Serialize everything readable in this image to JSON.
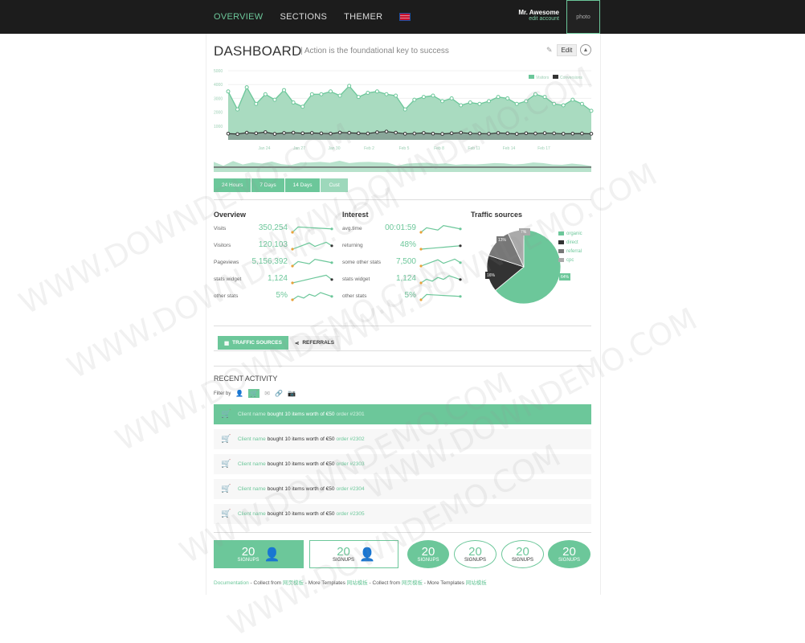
{
  "nav": {
    "items": [
      "OVERVIEW",
      "SECTIONS",
      "THEMER"
    ]
  },
  "user": {
    "name": "Mr. Awesome",
    "edit": "edit account",
    "photo": "photo"
  },
  "header": {
    "title": "DASHBOARD",
    "subtitle": "| Action is the foundational key to success",
    "edit": "Edit"
  },
  "chart_data": {
    "type": "line",
    "x": [
      "Jan 24",
      "Jan 27",
      "Jan 30",
      "Feb 2",
      "Feb 5",
      "Feb 8",
      "Feb 11",
      "Feb 14",
      "Feb 17"
    ],
    "y_ticks": [
      "5000",
      "4000",
      "3000",
      "2000",
      "1000"
    ],
    "ylim": [
      0,
      5000
    ],
    "legend": "top-right",
    "series": [
      {
        "name": "Visitors",
        "values": [
          3500,
          2200,
          3800,
          2600,
          3300,
          2900,
          3600,
          2700,
          2400,
          3300,
          3300,
          3500,
          3200,
          3900,
          3100,
          3400,
          3500,
          3300,
          3200,
          2200,
          2900,
          3100,
          3200,
          2800,
          3000,
          2500,
          2700,
          2600,
          2800,
          3100,
          3000,
          2600,
          2800,
          3300,
          3100,
          2600,
          2500,
          2900,
          2600,
          2100
        ]
      },
      {
        "name": "Conversions",
        "values": [
          450,
          420,
          520,
          480,
          560,
          430,
          500,
          520,
          480,
          500,
          470,
          450,
          530,
          510,
          480,
          460,
          550,
          600,
          520,
          440,
          460,
          500,
          450,
          430,
          480,
          520,
          470,
          460,
          440,
          500,
          470,
          430,
          480,
          460,
          490,
          470,
          440,
          450,
          460,
          440
        ]
      }
    ],
    "colors": {
      "visitors": "#6cc79a",
      "conversions": "#333333"
    }
  },
  "ranges": [
    "24 Hours",
    "7 Days",
    "14 Days",
    "Cust"
  ],
  "overview": {
    "title": "Overview",
    "rows": [
      {
        "label": "Visits",
        "value": "350,254"
      },
      {
        "label": "Visitors",
        "value": "120,103"
      },
      {
        "label": "Pageviews",
        "value": "5,156,392"
      },
      {
        "label": "stats widget",
        "value": "1,124"
      },
      {
        "label": "other stats",
        "value": "5%"
      }
    ]
  },
  "interest": {
    "title": "Interest",
    "rows": [
      {
        "label": "avg.time",
        "value": "00:01:59"
      },
      {
        "label": "returning",
        "value": "48%"
      },
      {
        "label": "some other stats",
        "value": "7,500"
      },
      {
        "label": "stats widget",
        "value": "1,124"
      },
      {
        "label": "other stats",
        "value": "5%"
      }
    ]
  },
  "traffic": {
    "title": "Traffic sources",
    "slices": [
      {
        "name": "organic",
        "value": 64,
        "color": "#6cc79a"
      },
      {
        "name": "direct",
        "value": 16,
        "color": "#333333"
      },
      {
        "name": "referral",
        "value": 13,
        "color": "#777777"
      },
      {
        "name": "cpc",
        "value": 7,
        "color": "#aaaaaa"
      }
    ],
    "labels": [
      "64%",
      "16%",
      "13%",
      "7%"
    ]
  },
  "tabs": {
    "traffic": "TRAFFIC SOURCES",
    "referrals": "REFERRALS"
  },
  "activity": {
    "title": "RECENT ACTIVITY",
    "filter": "Filter by",
    "items": [
      {
        "client": "Client name",
        "text": "bought 10 items worth of €50",
        "order": "order #2301"
      },
      {
        "client": "Client name",
        "text": "bought 10 items worth of €50",
        "order": "order #2302"
      },
      {
        "client": "Client name",
        "text": "bought 10 items worth of €50",
        "order": "order #2303"
      },
      {
        "client": "Client name",
        "text": "bought 10 items worth of €50",
        "order": "order #2304"
      },
      {
        "client": "Client name",
        "text": "bought 10 items worth of €50",
        "order": "order #2305"
      }
    ]
  },
  "signups": {
    "num": "20",
    "label": "SIGNUPS"
  },
  "footer": {
    "doc": "Documentation",
    "t1": " - Collect from ",
    "l1": "网页模板",
    "t2": " - More Templates ",
    "l2": "网站模板",
    "t3": " - Collect from ",
    "l3": "网页模板",
    "t4": " - More Templates ",
    "l4": "网站模板"
  },
  "watermark": "WWW.DOWNDEMO.COM"
}
